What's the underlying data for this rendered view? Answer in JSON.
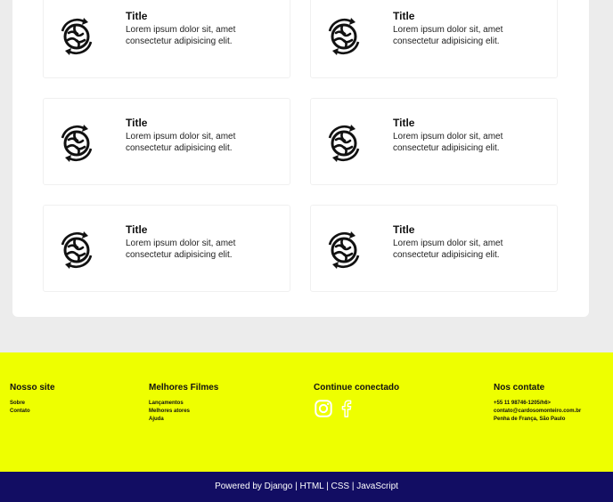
{
  "cards": [
    {
      "icon": "globe-exchange-icon",
      "title": "Title",
      "description": "Lorem ipsum dolor sit, amet consectetur adipisicing elit."
    },
    {
      "icon": "globe-exchange-icon",
      "title": "Title",
      "description": "Lorem ipsum dolor sit, amet consectetur adipisicing elit."
    },
    {
      "icon": "globe-exchange-icon",
      "title": "Title",
      "description": "Lorem ipsum dolor sit, amet consectetur adipisicing elit."
    },
    {
      "icon": "globe-exchange-icon",
      "title": "Title",
      "description": "Lorem ipsum dolor sit, amet consectetur adipisicing elit."
    },
    {
      "icon": "globe-exchange-icon",
      "title": "Title",
      "description": "Lorem ipsum dolor sit, amet consectetur adipisicing elit."
    },
    {
      "icon": "globe-exchange-icon",
      "title": "Title",
      "description": "Lorem ipsum dolor sit, amet consectetur adipisicing elit."
    }
  ],
  "footer": {
    "site": {
      "heading": "Nosso site",
      "links": [
        "Sobre",
        "Contato"
      ]
    },
    "movies": {
      "heading": "Melhores Filmes",
      "links": [
        "Lançamentos",
        "Melhores atores",
        "Ajuda"
      ]
    },
    "connected": {
      "heading": "Continue conectado",
      "icons": [
        "instagram-icon",
        "facebook-icon"
      ]
    },
    "contact": {
      "heading": "Nos contate",
      "lines": [
        "+55 11 98746-1205/h6>",
        "contato@cardosomonteiro.com.br",
        "Penha de França, São Paulo"
      ]
    }
  },
  "bottom_bar": {
    "text": "Powered by Django | HTML | CSS | JavaScript"
  },
  "colors": {
    "footer_bg": "#eeff00",
    "bottom_bar_bg": "#120d63",
    "page_bg": "#ececec"
  }
}
